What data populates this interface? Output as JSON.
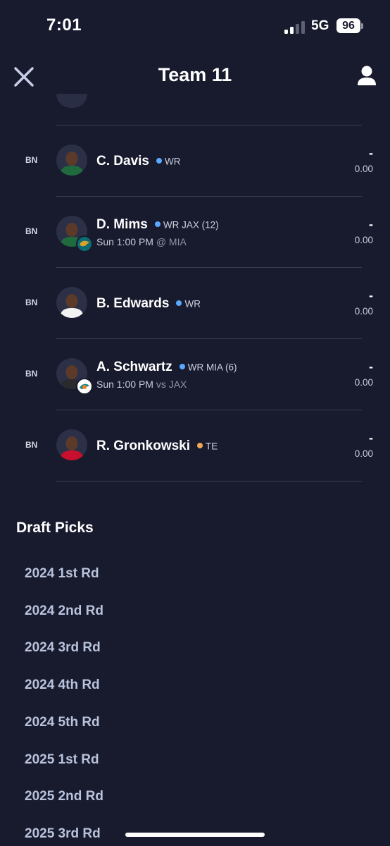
{
  "status_bar": {
    "time": "7:01",
    "network": "5G",
    "battery": "96",
    "icons": [
      "signal-bars-icon",
      "battery-icon"
    ]
  },
  "nav": {
    "title": "Team 11",
    "close_icon": "close-x-icon",
    "profile_icon": "person-icon"
  },
  "players": [
    {
      "slot": "BN",
      "name": "C. Davis",
      "position": "WR",
      "team_info": "",
      "game_time": "",
      "opponent": "",
      "score": "-",
      "points": "0.00",
      "dot_color": "#5aa8ff",
      "jersey_color": "#1f6b3e",
      "team_logo": ""
    },
    {
      "slot": "BN",
      "name": "D. Mims",
      "position": "WR",
      "team_info": "JAX (12)",
      "game_time": "Sun 1:00 PM",
      "opponent": "@ MIA",
      "score": "-",
      "points": "0.00",
      "dot_color": "#5aa8ff",
      "jersey_color": "#1f6b3e",
      "team_logo": "jaguars-logo-icon"
    },
    {
      "slot": "BN",
      "name": "B. Edwards",
      "position": "WR",
      "team_info": "",
      "game_time": "",
      "opponent": "",
      "score": "-",
      "points": "0.00",
      "dot_color": "#5aa8ff",
      "jersey_color": "#f2f2f2",
      "team_logo": ""
    },
    {
      "slot": "BN",
      "name": "A. Schwartz",
      "position": "WR",
      "team_info": "MIA (6)",
      "game_time": "Sun 1:00 PM",
      "opponent": "vs JAX",
      "score": "-",
      "points": "0.00",
      "dot_color": "#5aa8ff",
      "jersey_color": "#2a2a2e",
      "team_logo": "dolphins-logo-icon"
    },
    {
      "slot": "BN",
      "name": "R. Gronkowski",
      "position": "TE",
      "team_info": "",
      "game_time": "",
      "opponent": "",
      "score": "-",
      "points": "0.00",
      "dot_color": "#f0a950",
      "jersey_color": "#c8102e",
      "team_logo": ""
    }
  ],
  "draft_picks": {
    "title": "Draft Picks",
    "picks": [
      "2024 1st Rd",
      "2024 2nd Rd",
      "2024 3rd Rd",
      "2024 4th Rd",
      "2024 5th Rd",
      "2025 1st Rd",
      "2025 2nd Rd",
      "2025 3rd Rd"
    ]
  },
  "colors": {
    "background": "#181b2e",
    "divider": "#3a3e56",
    "draft_pick_text": "#b9c3dc"
  }
}
